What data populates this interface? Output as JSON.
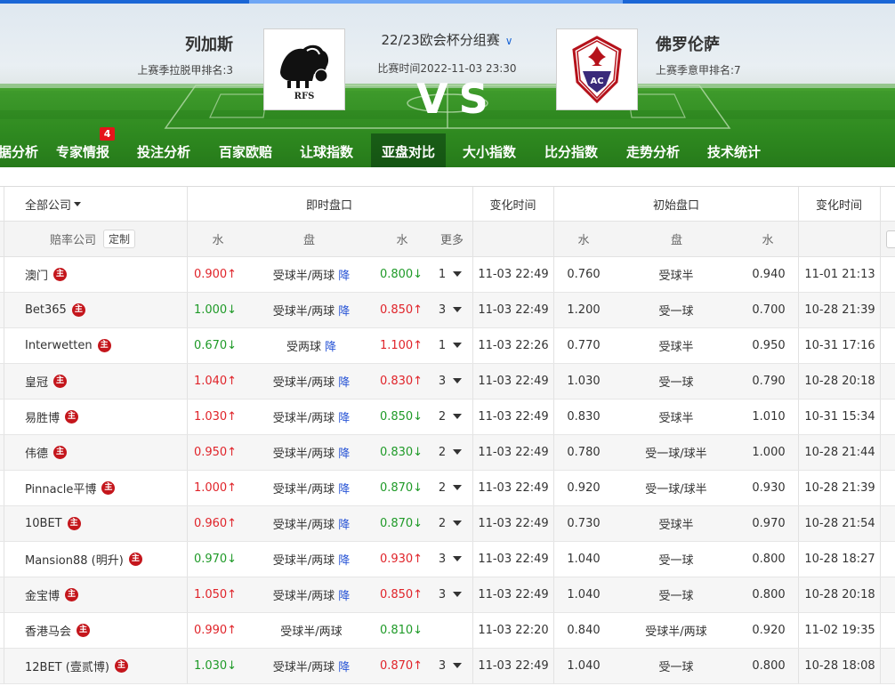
{
  "match": {
    "home_name": "列加斯",
    "home_rank": "上赛季拉脱甲排名:3",
    "home_logo_text": "RFS",
    "league": "22/23欧会杯分组赛",
    "match_time": "比赛时间2022-11-03 23:30",
    "vs": "VS",
    "away_name": "佛罗伦萨",
    "away_rank": "上赛季意甲排名:7",
    "away_logo_text": "AC"
  },
  "nav": {
    "tabs": [
      "据分析",
      "专家情报",
      "投注分析",
      "百家欧赔",
      "让球指数",
      "亚盘对比",
      "大小指数",
      "比分指数",
      "走势分析",
      "技术统计"
    ],
    "badge": "4",
    "active": "亚盘对比"
  },
  "table": {
    "header1": {
      "company_filter": "全部公司",
      "live": "即时盘口",
      "change_time": "变化时间",
      "initial": "初始盘口",
      "change_time2": "变化时间"
    },
    "header2": {
      "company": "赔率公司",
      "custom": "定制",
      "water1": "水",
      "handicap": "盘",
      "water2": "水",
      "more": "更多",
      "init_water1": "水",
      "init_handicap": "盘",
      "init_water2": "水"
    },
    "main_badge": "主",
    "dec_label": "降",
    "rows": [
      {
        "company": "澳门",
        "w1": "0.900",
        "w1dir": "up",
        "hc": "受球半/两球",
        "dec": true,
        "w2": "0.800",
        "w2dir": "down",
        "more": "1",
        "time": "11-03 22:49",
        "iw1": "0.760",
        "ihc": "受球半",
        "iw2": "0.940",
        "itime": "11-01 21:13"
      },
      {
        "company": "Bet365",
        "w1": "1.000",
        "w1dir": "down",
        "hc": "受球半/两球",
        "dec": true,
        "w2": "0.850",
        "w2dir": "up",
        "more": "3",
        "time": "11-03 22:49",
        "iw1": "1.200",
        "ihc": "受一球",
        "iw2": "0.700",
        "itime": "10-28 21:39"
      },
      {
        "company": "Interwetten",
        "w1": "0.670",
        "w1dir": "down",
        "hc": "受两球",
        "dec": true,
        "w2": "1.100",
        "w2dir": "up",
        "more": "1",
        "time": "11-03 22:26",
        "iw1": "0.770",
        "ihc": "受球半",
        "iw2": "0.950",
        "itime": "10-31 17:16"
      },
      {
        "company": "皇冠",
        "w1": "1.040",
        "w1dir": "up",
        "hc": "受球半/两球",
        "dec": true,
        "w2": "0.830",
        "w2dir": "up",
        "more": "3",
        "time": "11-03 22:49",
        "iw1": "1.030",
        "ihc": "受一球",
        "iw2": "0.790",
        "itime": "10-28 20:18"
      },
      {
        "company": "易胜博",
        "w1": "1.030",
        "w1dir": "up",
        "hc": "受球半/两球",
        "dec": true,
        "w2": "0.850",
        "w2dir": "down",
        "more": "2",
        "time": "11-03 22:49",
        "iw1": "0.830",
        "ihc": "受球半",
        "iw2": "1.010",
        "itime": "10-31 15:34"
      },
      {
        "company": "伟德",
        "w1": "0.950",
        "w1dir": "up",
        "hc": "受球半/两球",
        "dec": true,
        "w2": "0.830",
        "w2dir": "down",
        "more": "2",
        "time": "11-03 22:49",
        "iw1": "0.780",
        "ihc": "受一球/球半",
        "iw2": "1.000",
        "itime": "10-28 21:44"
      },
      {
        "company": "Pinnacle平博",
        "w1": "1.000",
        "w1dir": "up",
        "hc": "受球半/两球",
        "dec": true,
        "w2": "0.870",
        "w2dir": "down",
        "more": "2",
        "time": "11-03 22:49",
        "iw1": "0.920",
        "ihc": "受一球/球半",
        "iw2": "0.930",
        "itime": "10-28 21:39"
      },
      {
        "company": "10BET",
        "w1": "0.960",
        "w1dir": "up",
        "hc": "受球半/两球",
        "dec": true,
        "w2": "0.870",
        "w2dir": "down",
        "more": "2",
        "time": "11-03 22:49",
        "iw1": "0.730",
        "ihc": "受球半",
        "iw2": "0.970",
        "itime": "10-28 21:54"
      },
      {
        "company": "Mansion88 (明升)",
        "w1": "0.970",
        "w1dir": "down",
        "hc": "受球半/两球",
        "dec": true,
        "w2": "0.930",
        "w2dir": "up",
        "more": "3",
        "time": "11-03 22:49",
        "iw1": "1.040",
        "ihc": "受一球",
        "iw2": "0.800",
        "itime": "10-28 18:27"
      },
      {
        "company": "金宝博",
        "w1": "1.050",
        "w1dir": "up",
        "hc": "受球半/两球",
        "dec": true,
        "w2": "0.850",
        "w2dir": "up",
        "more": "3",
        "time": "11-03 22:49",
        "iw1": "1.040",
        "ihc": "受一球",
        "iw2": "0.800",
        "itime": "10-28 20:18"
      },
      {
        "company": "香港马会",
        "w1": "0.990",
        "w1dir": "up",
        "hc": "受球半/两球",
        "dec": false,
        "w2": "0.810",
        "w2dir": "down",
        "more": "",
        "time": "11-03 22:20",
        "iw1": "0.840",
        "ihc": "受球半/两球",
        "iw2": "0.920",
        "itime": "11-02 19:35"
      },
      {
        "company": "12BET (壹贰博)",
        "w1": "1.030",
        "w1dir": "down",
        "hc": "受球半/两球",
        "dec": true,
        "w2": "0.870",
        "w2dir": "up",
        "more": "3",
        "time": "11-03 22:49",
        "iw1": "1.040",
        "ihc": "受一球",
        "iw2": "0.800",
        "itime": "10-28 18:08"
      }
    ]
  },
  "colors": {
    "up": "#e0242a",
    "down": "#1f9a28",
    "accent": "#1b66d6",
    "pitch": "#2f8a20"
  }
}
